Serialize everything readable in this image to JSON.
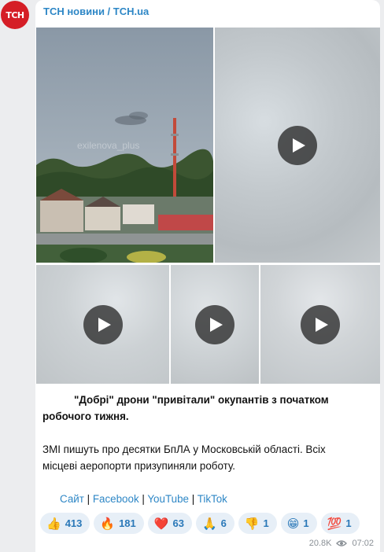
{
  "channel": {
    "avatar_text": "ТСН",
    "avatar_color": "#d51e26",
    "name": "ТСН новини / TCH.ua"
  },
  "media": {
    "photo_watermark": "exilenova_plus"
  },
  "post": {
    "title_line1": "\"Добрі\" дрони \"привітали\" окупантів з початком",
    "title_line2": "робочого тижня.",
    "body_line1": "ЗМІ пишуть про десятки БпЛА у Московській області. Всіх",
    "body_line2": "місцеві аеропорти призупиняли роботу.",
    "links": {
      "site": "Сайт",
      "facebook": "Facebook",
      "youtube": "YouTube",
      "tiktok": "TikTok",
      "separator": "|"
    }
  },
  "reactions": [
    {
      "emoji": "👍",
      "icon": "thumbs-up-icon",
      "count": "413"
    },
    {
      "emoji": "🔥",
      "icon": "fire-icon",
      "count": "181"
    },
    {
      "emoji": "❤️",
      "icon": "heart-icon",
      "count": "63"
    },
    {
      "emoji": "🙏",
      "icon": "pray-icon",
      "count": "6"
    },
    {
      "emoji": "👎",
      "icon": "thumbs-down-icon",
      "count": "1"
    },
    {
      "emoji": "😁",
      "icon": "grin-icon",
      "count": "1"
    },
    {
      "emoji": "💯",
      "icon": "hundred-icon",
      "count": "1"
    }
  ],
  "footer": {
    "views": "20.8K",
    "time": "07:02"
  },
  "colors": {
    "accent": "#2e87c6",
    "reaction_bg": "#e7eff7",
    "background": "#ecedef"
  }
}
